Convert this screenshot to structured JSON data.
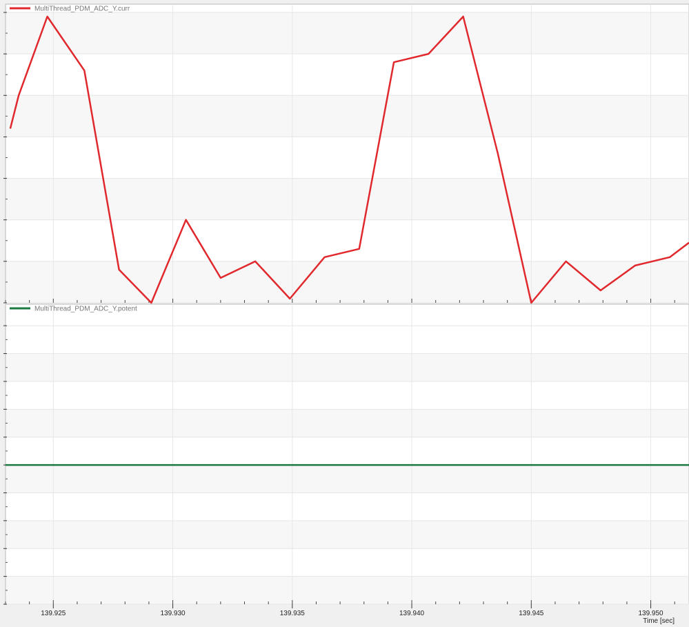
{
  "chart_data": [
    {
      "type": "line",
      "series": [
        {
          "name": "MultiThread_PDM_ADC_Y.curr",
          "color": "#e0282d",
          "x": [
            139.9232,
            139.92355,
            139.92475,
            139.9263,
            139.92775,
            139.9291,
            139.93055,
            139.932,
            139.93345,
            139.9349,
            139.93635,
            139.9378,
            139.93925,
            139.9407,
            139.94215,
            139.9436,
            139.945,
            139.94645,
            139.9479,
            139.94935,
            139.9508,
            139.9516
          ],
          "y": [
            4.2,
            5.0,
            6.9,
            5.6,
            0.8,
            0.0,
            2.0,
            0.6,
            1.0,
            0.1,
            1.1,
            1.3,
            5.8,
            6.0,
            6.9,
            3.6,
            0.0,
            1.0,
            0.3,
            0.9,
            1.1,
            1.45
          ]
        }
      ],
      "xlim": [
        139.923,
        139.9516
      ],
      "ylim": [
        0,
        7.0
      ],
      "y_ticks": [
        0,
        1,
        2,
        3,
        4,
        5,
        6,
        7
      ]
    },
    {
      "type": "line",
      "series": [
        {
          "name": "MultiThread_PDM_ADC_Y.potent",
          "color": "#1a7a40",
          "x": [
            139.923,
            139.9516
          ],
          "y": [
            0,
            0
          ]
        }
      ],
      "xlim": [
        139.923,
        139.9516
      ],
      "ylim": [
        -1.0,
        1.1
      ],
      "y_ticks": [
        -1.0,
        -0.8,
        -0.6,
        -0.4,
        -0.2,
        0.0,
        0.2,
        0.4,
        0.6,
        0.8,
        1.0
      ]
    }
  ],
  "x_axis": {
    "ticks": [
      139.925,
      139.93,
      139.935,
      139.94,
      139.945,
      139.95
    ],
    "tick_labels": [
      "139.925",
      "139.930",
      "139.935",
      "139.940",
      "139.945",
      "139.950"
    ],
    "label": "Time [sec]"
  }
}
